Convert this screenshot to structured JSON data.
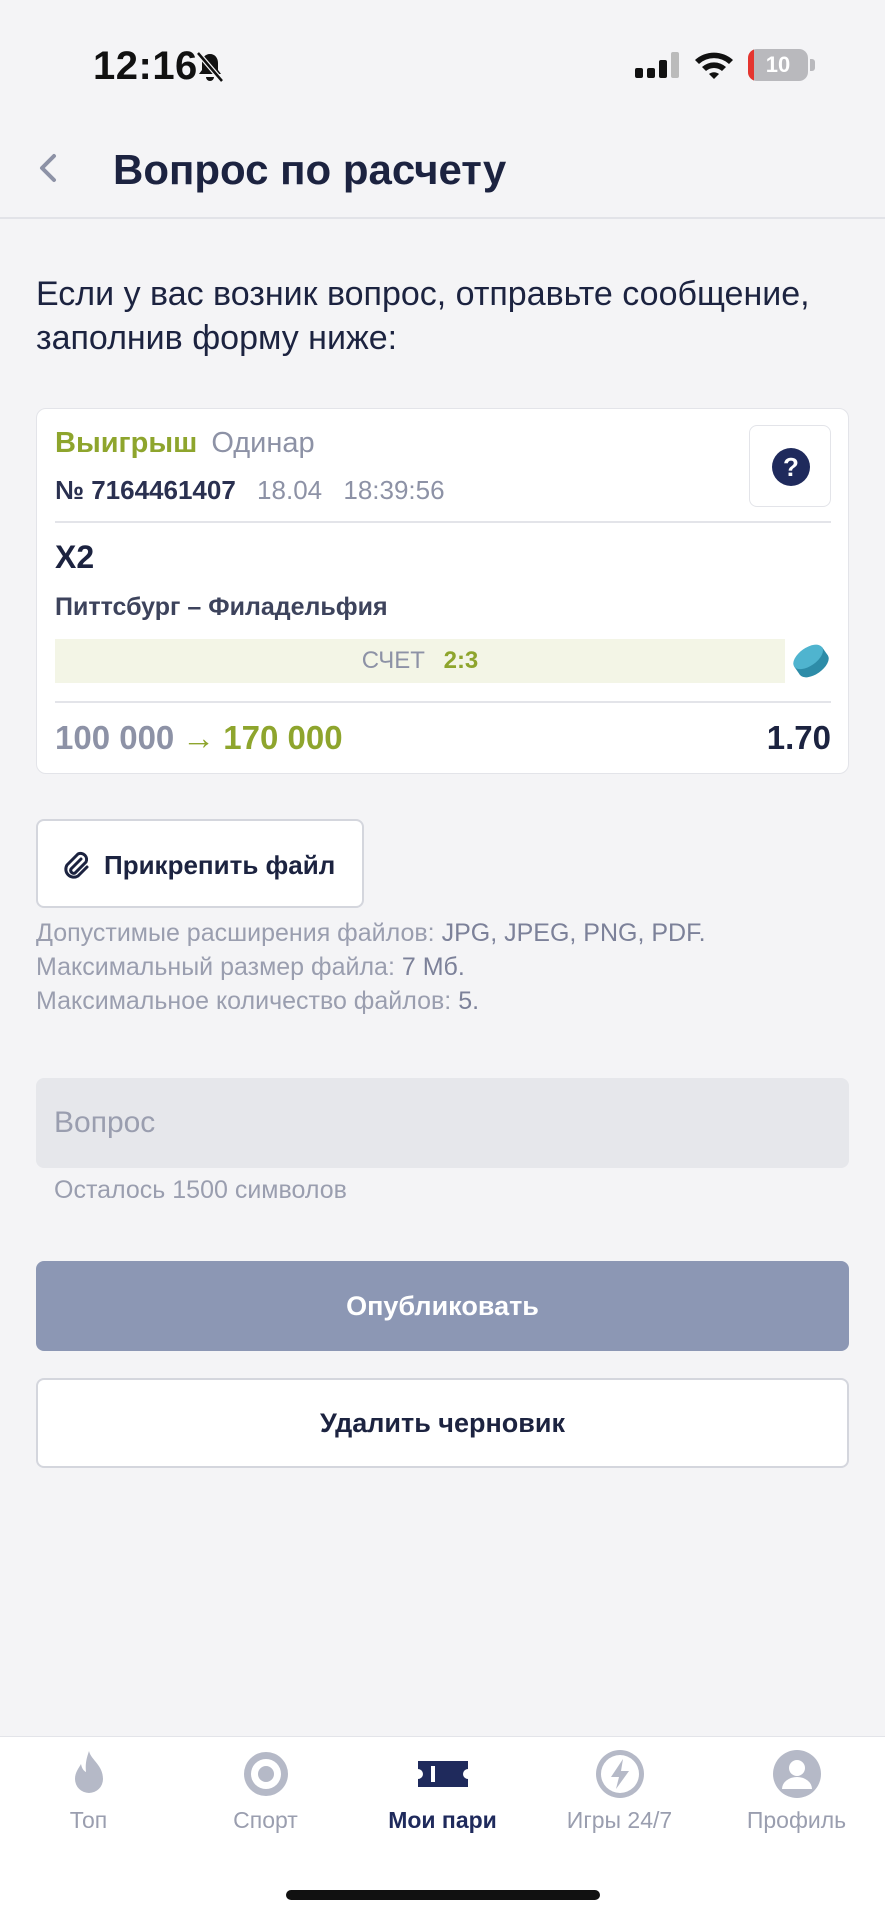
{
  "status_bar": {
    "time": "12:16",
    "battery": "10"
  },
  "header": {
    "title": "Вопрос по расчету"
  },
  "intro": "Если у вас возник вопрос, отправьте сообщение, заполнив форму ниже:",
  "bet": {
    "status": "Выигрыш",
    "type": "Одинар",
    "number": "№ 7164461407",
    "date": "18.04",
    "time": "18:39:56",
    "outcome": "X2",
    "event": "Питтсбург – Филадельфия",
    "score_label": "СЧЕТ",
    "score": "2:3",
    "stake": "100 000",
    "payout": "170 000",
    "odds": "1.70"
  },
  "attach": {
    "label": "Прикрепить файл"
  },
  "file_info": {
    "ext_label": "Допустимые расширения файлов:",
    "ext_value": "JPG, JPEG, PNG, PDF.",
    "size_label": "Максимальный размер файла:",
    "size_value": "7 Мб.",
    "count_label": "Максимальное количество файлов:",
    "count_value": "5."
  },
  "question": {
    "placeholder": "Вопрос",
    "chars_left": "Осталось 1500 символов"
  },
  "buttons": {
    "publish": "Опубликовать",
    "delete_draft": "Удалить черновик"
  },
  "tabs": [
    {
      "label": "Топ",
      "icon": "flame-icon"
    },
    {
      "label": "Спорт",
      "icon": "sport-icon"
    },
    {
      "label": "Мои пари",
      "icon": "ticket-icon"
    },
    {
      "label": "Игры 24/7",
      "icon": "lightning-icon"
    },
    {
      "label": "Профиль",
      "icon": "profile-icon"
    }
  ],
  "colors": {
    "accent_green": "#8ea52d",
    "navy": "#1f2a5c",
    "button_disabled": "#8c97b4"
  }
}
